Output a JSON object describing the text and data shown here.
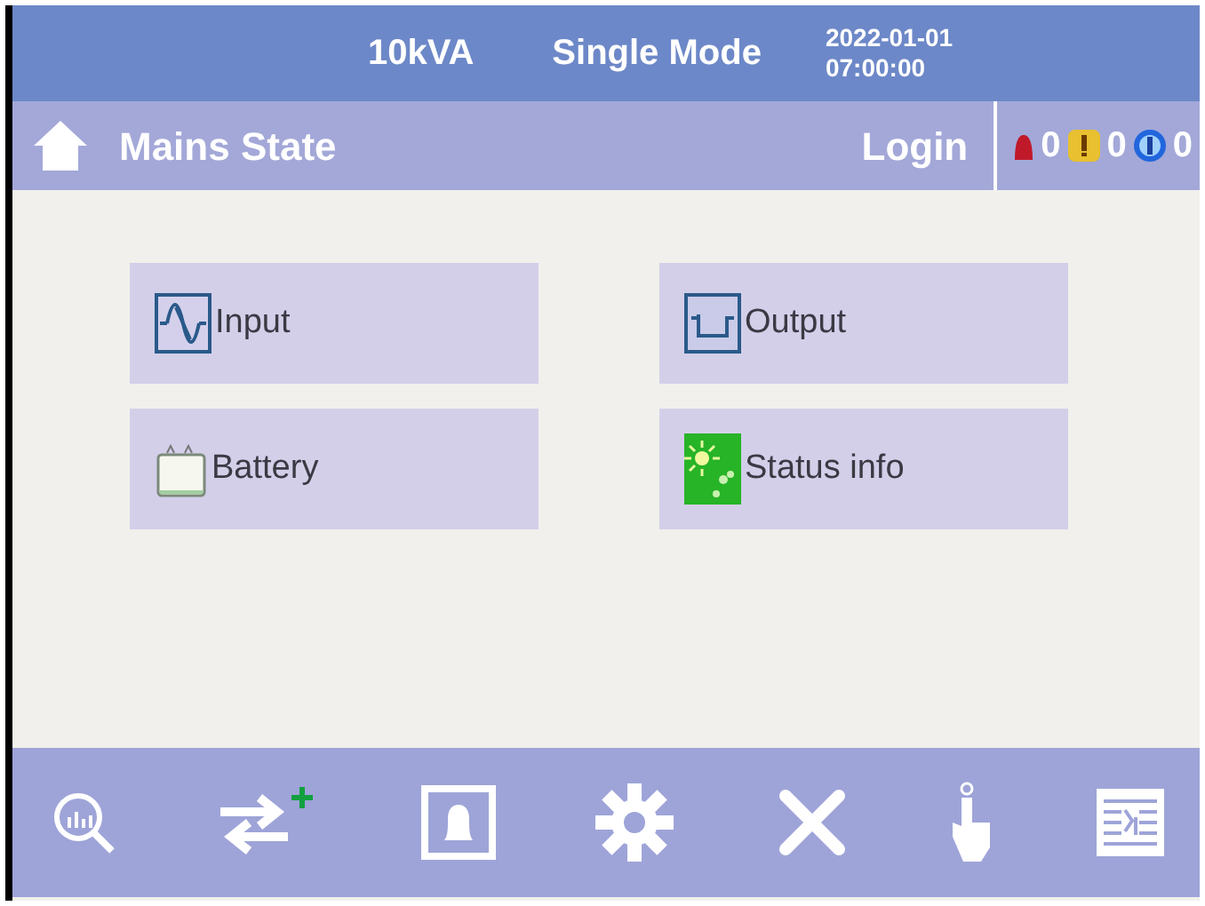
{
  "header": {
    "capacity": "10kVA",
    "mode": "Single Mode",
    "date": "2022-01-01",
    "time": "07:00:00"
  },
  "nav": {
    "title": "Mains State",
    "login": "Login"
  },
  "alarms": [
    {
      "kind": "critical",
      "count": "0"
    },
    {
      "kind": "warning",
      "count": "0"
    },
    {
      "kind": "info",
      "count": "0"
    }
  ],
  "menu": [
    {
      "kind": "input",
      "label": "Input"
    },
    {
      "kind": "output",
      "label": "Output"
    },
    {
      "kind": "battery",
      "label": "Battery"
    },
    {
      "kind": "status",
      "label": "Status info"
    }
  ],
  "toolbar": [
    {
      "kind": "analysis"
    },
    {
      "kind": "transfer"
    },
    {
      "kind": "alarm"
    },
    {
      "kind": "settings"
    },
    {
      "kind": "tools"
    },
    {
      "kind": "touch"
    },
    {
      "kind": "log"
    }
  ]
}
